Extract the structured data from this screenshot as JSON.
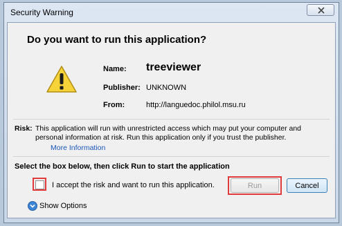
{
  "window": {
    "title": "Security Warning"
  },
  "dialog": {
    "question": "Do you want to run this application?",
    "name_label": "Name:",
    "name_value": "treeviewer",
    "publisher_label": "Publisher:",
    "publisher_value": "UNKNOWN",
    "from_label": "From:",
    "from_value": "http://languedoc.philol.msu.ru",
    "risk_label": "Risk:",
    "risk_text": "This application will run with unrestricted access which may put your computer and personal information at risk. Run this application only if you trust the publisher.",
    "more_info": "More Information",
    "select_instruction": "Select the box below, then click Run to start the application",
    "accept_text": "I accept the risk and want to run this application.",
    "accept_checked": false,
    "run_label": "Run",
    "cancel_label": "Cancel",
    "show_options": "Show Options"
  },
  "colors": {
    "highlight_red": "#e03a3a",
    "link_blue": "#1a56b7",
    "warning_yellow": "#f7d33a"
  },
  "icons": {
    "close": "close-icon",
    "warning": "warning-icon",
    "options": "chevron-down-icon"
  }
}
